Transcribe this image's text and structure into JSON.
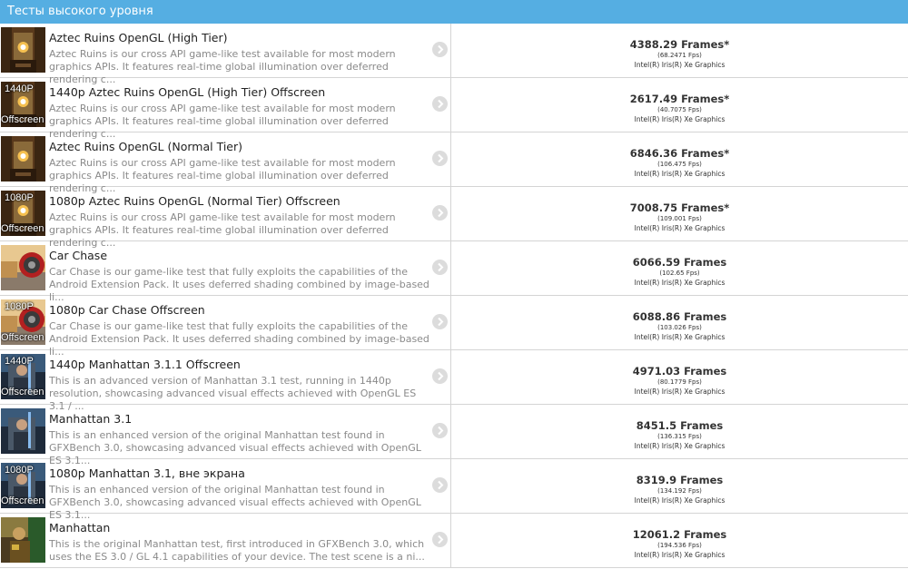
{
  "header": {
    "title": "Тесты высокого уровня"
  },
  "tests": [
    {
      "thumb": "aztec",
      "badge_top": "",
      "badge_bottom": "",
      "title": "Aztec Ruins OpenGL (High Tier)",
      "desc": "Aztec Ruins is our cross API game-like test available for most modern graphics APIs. It features real-time global illumination over deferred rendering c...",
      "score": "4388.29 Frames*",
      "fps": "(68.2471 Fps)",
      "gpu": "Intel(R) Iris(R) Xe Graphics"
    },
    {
      "thumb": "aztec",
      "badge_top": "1440P",
      "badge_bottom": "Offscreen",
      "title": "1440p Aztec Ruins OpenGL (High Tier) Offscreen",
      "desc": "Aztec Ruins is our cross API game-like test available for most modern graphics APIs. It features real-time global illumination over deferred rendering c...",
      "score": "2617.49 Frames*",
      "fps": "(40.7075 Fps)",
      "gpu": "Intel(R) Iris(R) Xe Graphics"
    },
    {
      "thumb": "aztec",
      "badge_top": "",
      "badge_bottom": "",
      "title": "Aztec Ruins OpenGL (Normal Tier)",
      "desc": "Aztec Ruins is our cross API game-like test available for most modern graphics APIs. It features real-time global illumination over deferred rendering c...",
      "score": "6846.36 Frames*",
      "fps": "(106.475 Fps)",
      "gpu": "Intel(R) Iris(R) Xe Graphics"
    },
    {
      "thumb": "aztec",
      "badge_top": "1080P",
      "badge_bottom": "Offscreen",
      "title": "1080p Aztec Ruins OpenGL (Normal Tier) Offscreen",
      "desc": "Aztec Ruins is our cross API game-like test available for most modern graphics APIs. It features real-time global illumination over deferred rendering c...",
      "score": "7008.75 Frames*",
      "fps": "(109.001 Fps)",
      "gpu": "Intel(R) Iris(R) Xe Graphics"
    },
    {
      "thumb": "carchase",
      "badge_top": "",
      "badge_bottom": "",
      "title": "Car Chase",
      "desc": "Car Chase is our game-like test that fully exploits the capabilities of the Android Extension Pack. It uses deferred shading combined by image-based li...",
      "score": "6066.59 Frames",
      "fps": "(102.65 Fps)",
      "gpu": "Intel(R) Iris(R) Xe Graphics"
    },
    {
      "thumb": "carchase",
      "badge_top": "1080P",
      "badge_bottom": "Offscreen",
      "title": "1080p Car Chase Offscreen",
      "desc": "Car Chase is our game-like test that fully exploits the capabilities of the Android Extension Pack. It uses deferred shading combined by image-based li...",
      "score": "6088.86 Frames",
      "fps": "(103.026 Fps)",
      "gpu": "Intel(R) Iris(R) Xe Graphics"
    },
    {
      "thumb": "manhattan31",
      "badge_top": "1440P",
      "badge_bottom": "Offscreen",
      "title": "1440p Manhattan 3.1.1 Offscreen",
      "desc": "This is an advanced version of Manhattan 3.1 test, running in 1440p resolution, showcasing advanced visual effects achieved with OpenGL ES 3.1 / ...",
      "score": "4971.03 Frames",
      "fps": "(80.1779 Fps)",
      "gpu": "Intel(R) Iris(R) Xe Graphics"
    },
    {
      "thumb": "manhattan31",
      "badge_top": "",
      "badge_bottom": "",
      "title": "Manhattan 3.1",
      "desc": "This is an enhanced version of the original Manhattan test found in GFXBench 3.0, showcasing advanced visual effects achieved with OpenGL ES 3.1...",
      "score": "8451.5 Frames",
      "fps": "(136.315 Fps)",
      "gpu": "Intel(R) Iris(R) Xe Graphics"
    },
    {
      "thumb": "manhattan31",
      "badge_top": "1080P",
      "badge_bottom": "Offscreen",
      "title": "1080p Manhattan 3.1, вне экрана",
      "desc": "This is an enhanced version of the original Manhattan test found in GFXBench 3.0, showcasing advanced visual effects achieved with OpenGL ES 3.1...",
      "score": "8319.9 Frames",
      "fps": "(134.192 Fps)",
      "gpu": "Intel(R) Iris(R) Xe Graphics"
    },
    {
      "thumb": "manhattan",
      "badge_top": "",
      "badge_bottom": "",
      "title": "Manhattan",
      "desc": "This is the original Manhattan test, first introduced in GFXBench 3.0, which uses the ES 3.0 / GL 4.1 capabilities of your device. The test scene is a ni...",
      "score": "12061.2 Frames",
      "fps": "(194.536 Fps)",
      "gpu": "Intel(R) Iris(R) Xe Graphics"
    }
  ]
}
